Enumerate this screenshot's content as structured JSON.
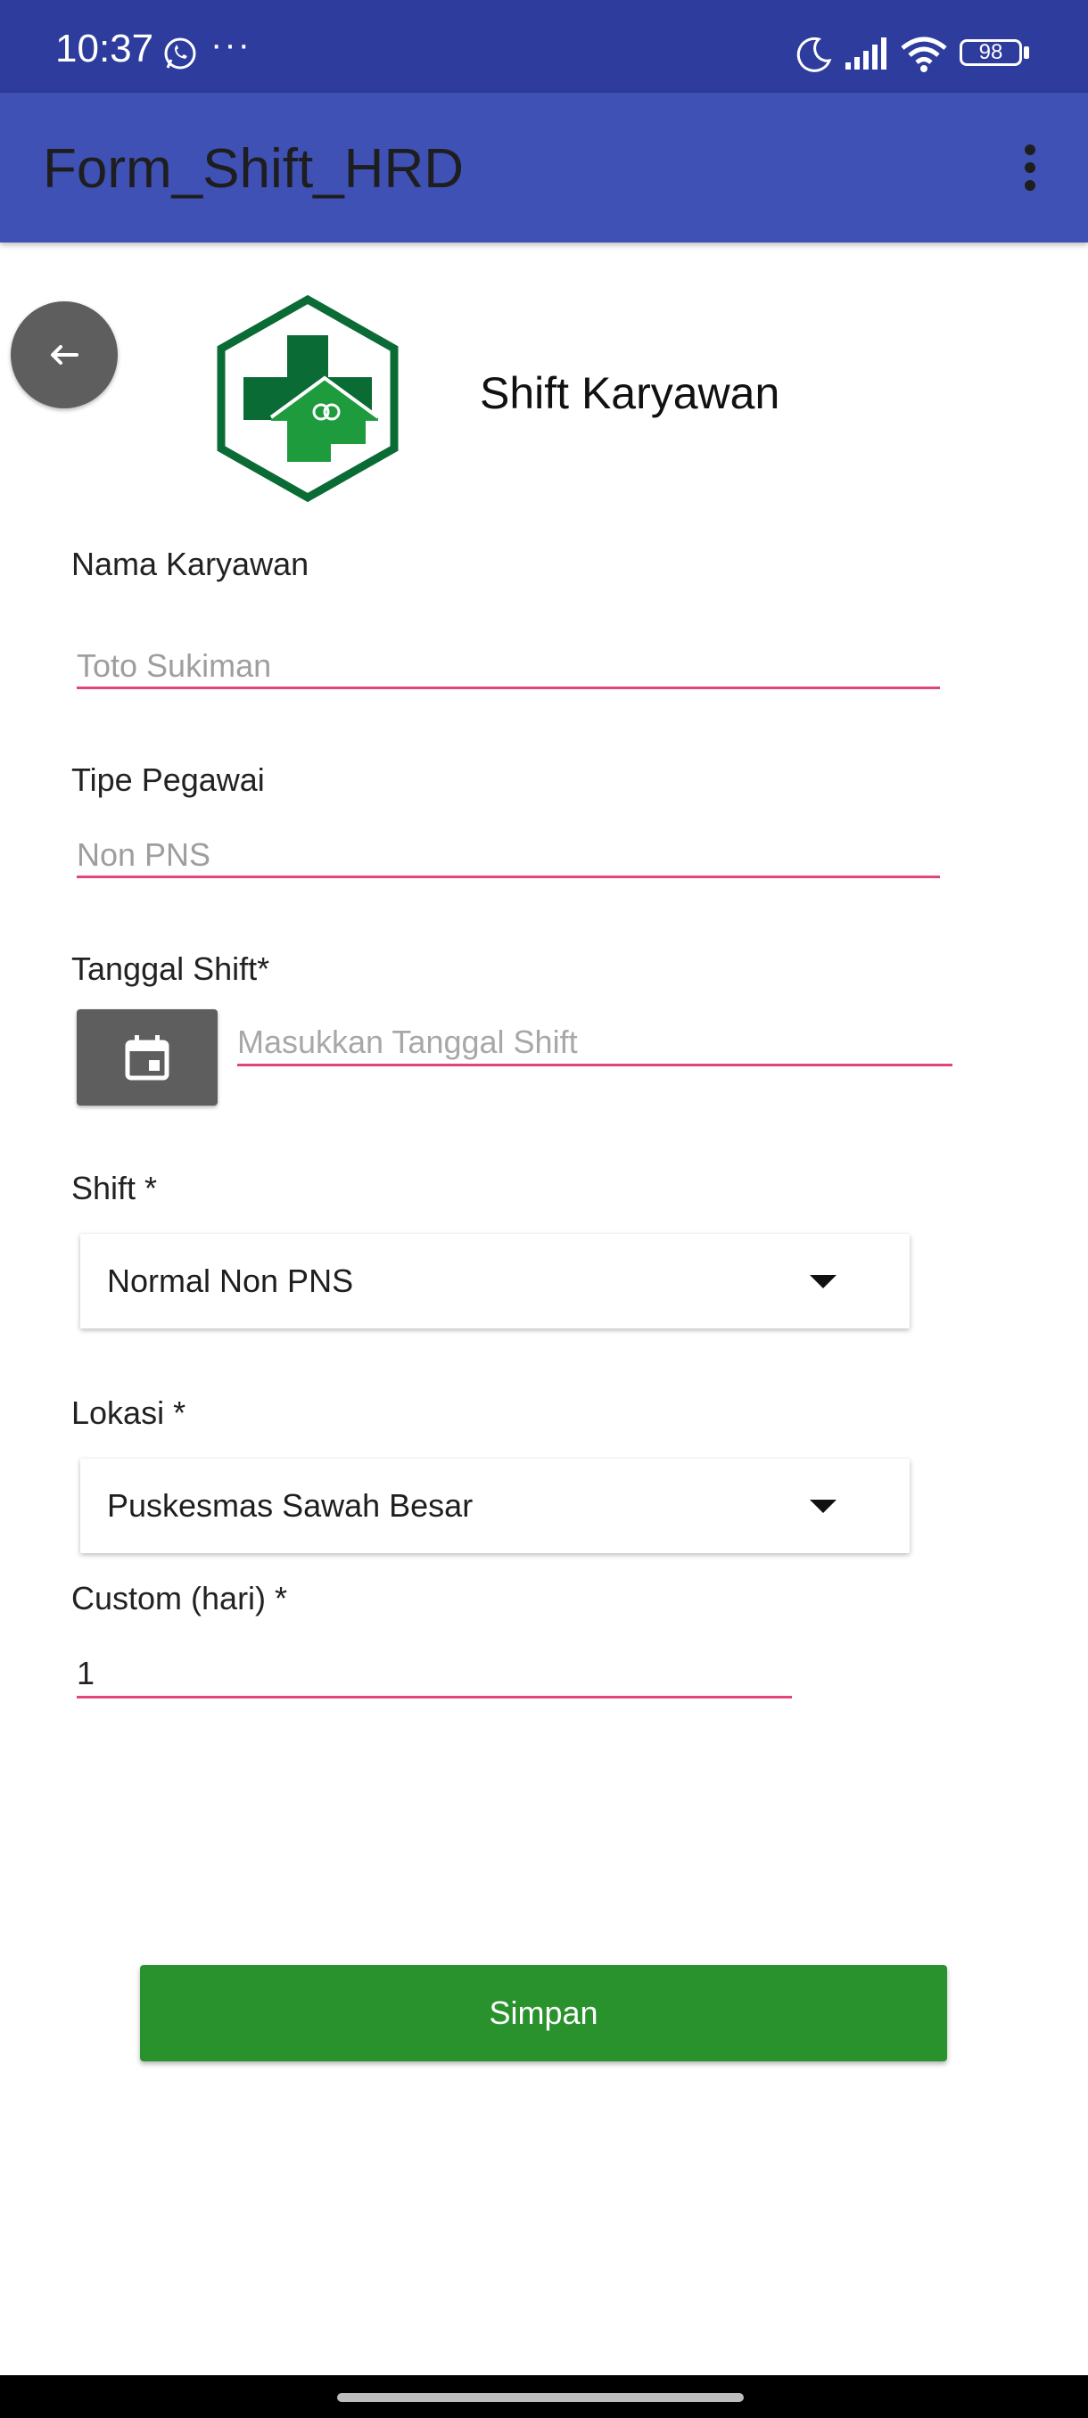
{
  "status_bar": {
    "time": "10:37",
    "battery": "98"
  },
  "app_bar": {
    "title": "Form_Shift_HRD"
  },
  "header": {
    "title": "Shift Karyawan"
  },
  "form": {
    "nama": {
      "label": "Nama Karyawan",
      "value": "Toto Sukiman"
    },
    "tipe": {
      "label": "Tipe Pegawai",
      "value": "Non PNS"
    },
    "tanggal": {
      "label": "Tanggal Shift*",
      "placeholder": "Masukkan Tanggal Shift"
    },
    "shift": {
      "label": "Shift *",
      "selected": "Normal Non PNS"
    },
    "lokasi": {
      "label": "Lokasi *",
      "selected": "Puskesmas Sawah Besar"
    },
    "custom": {
      "label": "Custom (hari) *",
      "value": "1"
    }
  },
  "actions": {
    "save_label": "Simpan"
  },
  "colors": {
    "status_bar": "#2d3c9d",
    "app_bar": "#3f51b5",
    "underline": "#e0457b",
    "save_button": "#2a922d",
    "logo_green_dark": "#0b6b35",
    "logo_green": "#1e9b3c"
  }
}
